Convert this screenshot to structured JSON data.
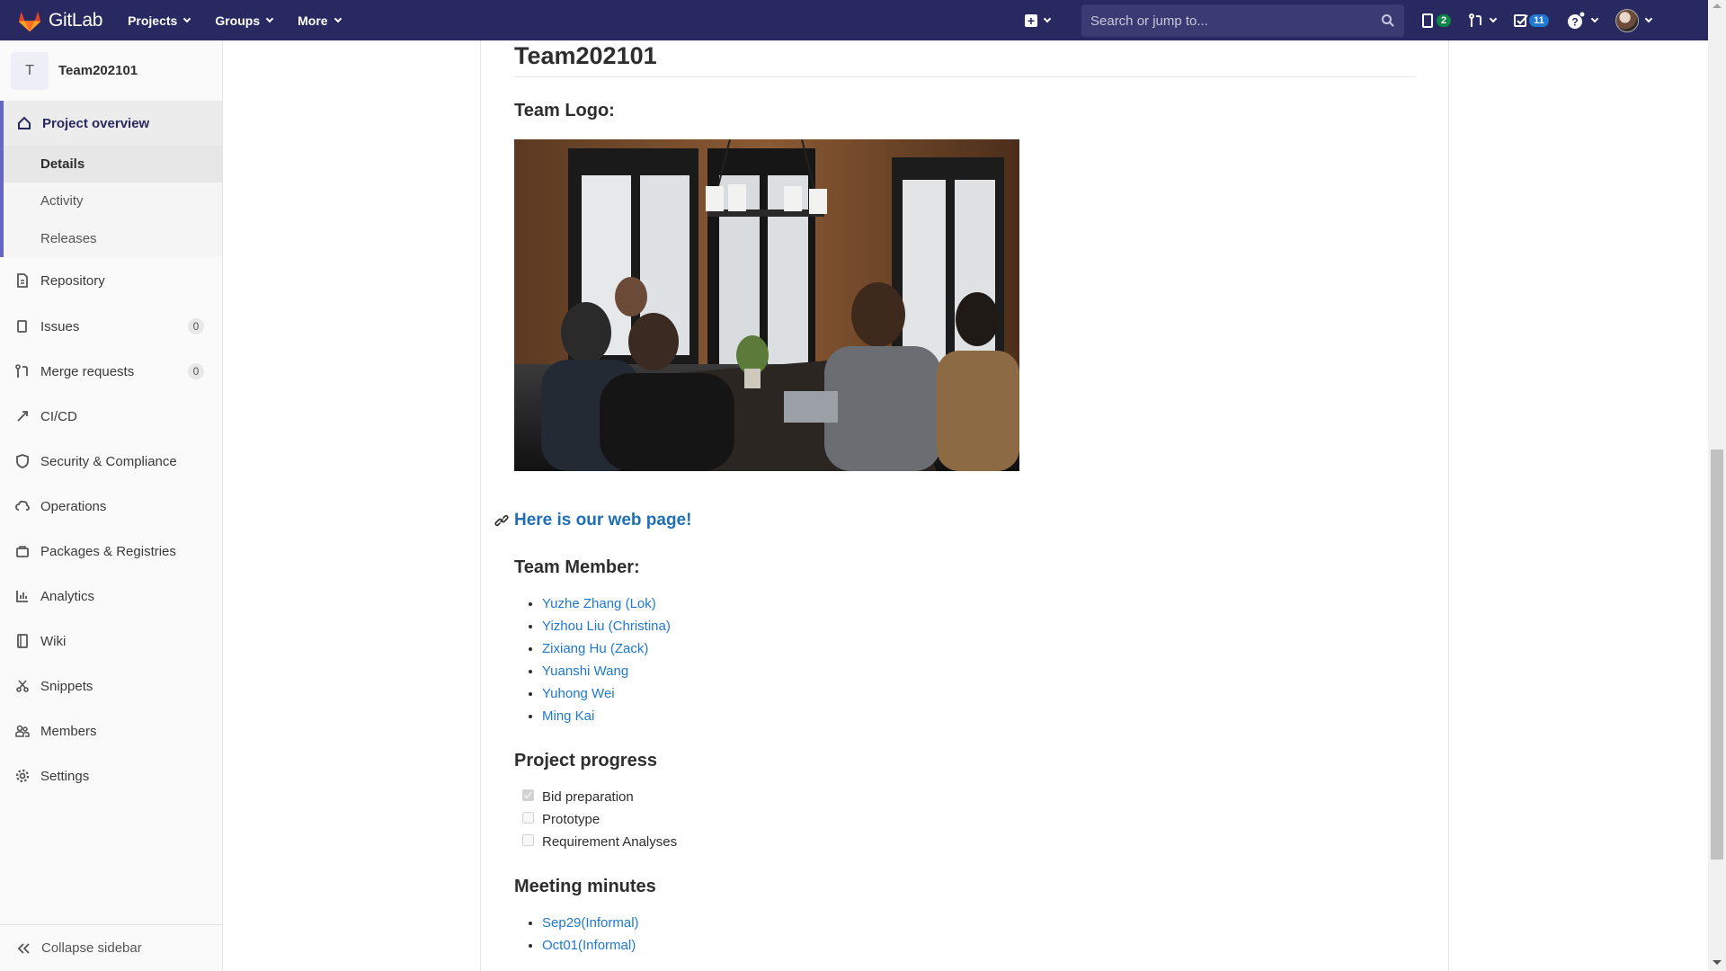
{
  "navbar": {
    "brand": "GitLab",
    "menu": [
      {
        "label": "Projects"
      },
      {
        "label": "Groups"
      },
      {
        "label": "More"
      }
    ],
    "search_placeholder": "Search or jump to...",
    "issues_count": "2",
    "todos_count": "11",
    "issues_badge_color": "#108548",
    "todos_badge_color": "#1f78d1",
    "bg_color": "#292961"
  },
  "sidebar": {
    "project_initial": "T",
    "project_name": "Team202101",
    "overview_label": "Project overview",
    "sub_items": [
      {
        "label": "Details"
      },
      {
        "label": "Activity"
      },
      {
        "label": "Releases"
      }
    ],
    "items": [
      {
        "label": "Repository",
        "icon": "document-icon"
      },
      {
        "label": "Issues",
        "icon": "issues-icon",
        "badge": "0"
      },
      {
        "label": "Merge requests",
        "icon": "merge-request-icon",
        "badge": "0"
      },
      {
        "label": "CI/CD",
        "icon": "rocket-icon"
      },
      {
        "label": "Security & Compliance",
        "icon": "shield-icon"
      },
      {
        "label": "Operations",
        "icon": "cloud-gear-icon"
      },
      {
        "label": "Packages & Registries",
        "icon": "package-icon"
      },
      {
        "label": "Analytics",
        "icon": "chart-icon"
      },
      {
        "label": "Wiki",
        "icon": "book-icon"
      },
      {
        "label": "Snippets",
        "icon": "scissors-icon"
      },
      {
        "label": "Members",
        "icon": "users-icon"
      },
      {
        "label": "Settings",
        "icon": "gear-icon"
      }
    ],
    "collapse_label": "Collapse sidebar"
  },
  "readme": {
    "title": "Team202101",
    "logo_heading": "Team Logo:",
    "webpage_link": "Here is our web page!",
    "members_heading": "Team Member:",
    "members": [
      "Yuzhe Zhang (Lok)",
      "Yizhou Liu (Christina)",
      "Zixiang Hu (Zack)",
      "Yuanshi Wang",
      "Yuhong Wei",
      "Ming Kai"
    ],
    "progress_heading": "Project progress",
    "progress": [
      {
        "label": "Bid preparation",
        "done": true
      },
      {
        "label": "Prototype",
        "done": false
      },
      {
        "label": "Requirement Analyses",
        "done": false
      }
    ],
    "minutes_heading": "Meeting minutes",
    "minutes": [
      "Sep29(Informal)",
      "Oct01(Informal)"
    ]
  }
}
